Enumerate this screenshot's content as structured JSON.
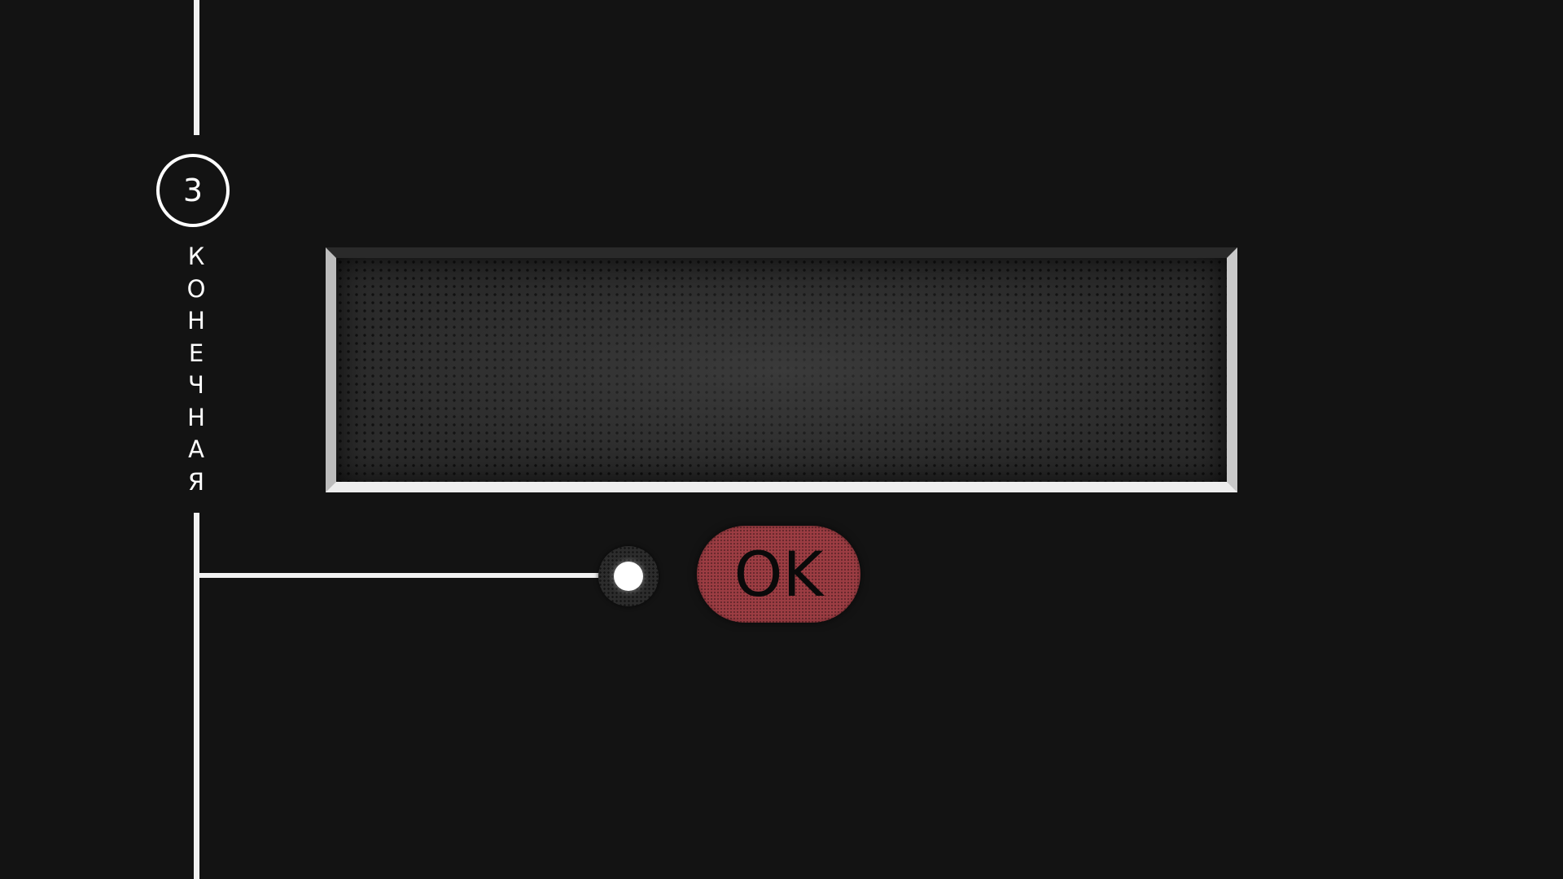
{
  "step": {
    "number": "3",
    "label_letters": [
      "К",
      "О",
      "Н",
      "Е",
      "Ч",
      "Н",
      "А",
      "Я"
    ]
  },
  "input": {
    "value": "",
    "placeholder": ""
  },
  "ok_button": {
    "label": "OK"
  },
  "colors": {
    "background": "#131313",
    "track": "#f2f2f2",
    "ok_button": "#9c3d43"
  }
}
